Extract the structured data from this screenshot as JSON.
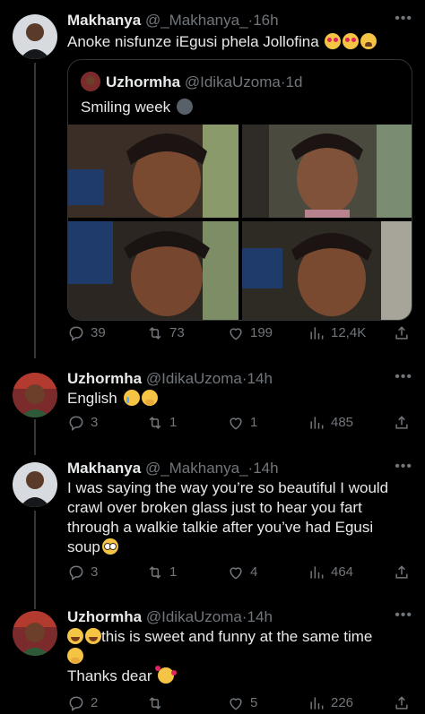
{
  "tweets": [
    {
      "name": "Makhanya",
      "handle": "@_Makhanya_",
      "time": "16h",
      "text": "Anoke nisfunze iEgusi phela Jollofina",
      "emojis": [
        "smiling-face-with-heart-eyes",
        "smiling-face-with-heart-eyes",
        "weary-face"
      ],
      "quote": {
        "name": "Uzhormha",
        "handle": "@IdikaUzoma",
        "time": "1d",
        "text": "Smiling week",
        "emojis": [
          "new-moon-face"
        ]
      },
      "replies": "39",
      "retweets": "73",
      "likes": "199",
      "views": "12,4K"
    },
    {
      "name": "Uzhormha",
      "handle": "@IdikaUzoma",
      "time": "14h",
      "text": "English",
      "emojis": [
        "crying-face",
        "face-with-hand-over-mouth"
      ],
      "replies": "3",
      "retweets": "1",
      "likes": "1",
      "views": "485"
    },
    {
      "name": "Makhanya",
      "handle": "@_Makhanya_",
      "time": "14h",
      "text": "I was saying the way you’re so beautiful I would crawl over broken glass just to hear you fart through a walkie talkie after you’ve had Egusi soup",
      "emojis": [
        "pleading-face"
      ],
      "replies": "3",
      "retweets": "1",
      "likes": "4",
      "views": "464"
    },
    {
      "name": "Uzhormha",
      "handle": "@IdikaUzoma",
      "time": "14h",
      "text_line1": "this is sweet and funny at the same time",
      "text_line2": "Thanks dear",
      "emojis": [
        "face-with-tears-of-joy",
        "face-with-tears-of-joy",
        "face-with-hand-over-mouth",
        "smiling-face-with-hearts"
      ],
      "replies": "2",
      "retweets": "",
      "likes": "5",
      "views": "226"
    }
  ],
  "icons": {
    "reply": "reply-icon",
    "retweet": "retweet-icon",
    "like": "heart-icon",
    "views": "views-icon",
    "share": "share-icon",
    "more": "more-icon"
  },
  "colors": {
    "background": "#000000",
    "text": "#e7e9ea",
    "muted": "#71767b",
    "border": "#2f3336"
  }
}
